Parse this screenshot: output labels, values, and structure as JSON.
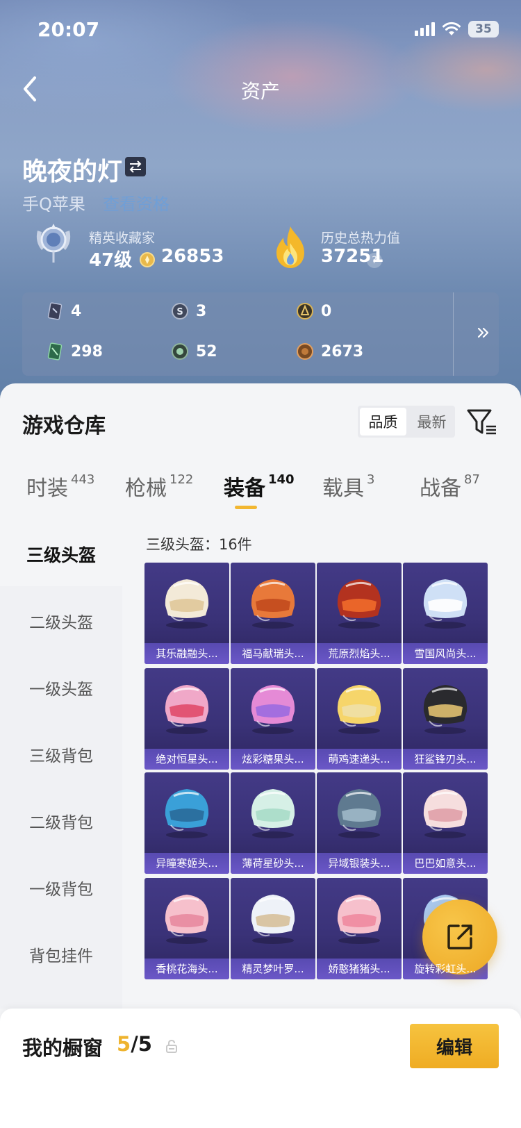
{
  "status_bar": {
    "time": "20:07",
    "battery": "35"
  },
  "header": {
    "title": "资产"
  },
  "profile": {
    "name": "晚夜的灯",
    "platform": "手Q苹果",
    "platform_extra": "查看资格",
    "rank_title": "精英收藏家",
    "rank_level": "47级",
    "rank_points": "26853",
    "heat_label": "历史总热力值",
    "heat_value": "37251",
    "help": "?"
  },
  "currencies": [
    {
      "icon": "dark-card-icon",
      "value": "4"
    },
    {
      "icon": "silver-coin-icon",
      "value": "3"
    },
    {
      "icon": "gold-emblem-icon",
      "value": "0"
    },
    {
      "icon": "green-card-icon",
      "value": "298"
    },
    {
      "icon": "green-orb-icon",
      "value": "52"
    },
    {
      "icon": "bronze-coin-icon",
      "value": "2673"
    }
  ],
  "warehouse": {
    "title": "游戏仓库",
    "sort_options": [
      "品质",
      "最新"
    ],
    "tabs": [
      {
        "label": "时装",
        "count": "443"
      },
      {
        "label": "枪械",
        "count": "122"
      },
      {
        "label": "装备",
        "count": "140"
      },
      {
        "label": "载具",
        "count": "3"
      },
      {
        "label": "战备",
        "count": "87"
      }
    ],
    "active_tab": "装备",
    "sub_categories": [
      "三级头盔",
      "二级头盔",
      "一级头盔",
      "三级背包",
      "二级背包",
      "一级背包",
      "背包挂件"
    ],
    "active_sub": "三级头盔",
    "grid_count": "三级头盔：16件",
    "items": [
      "其乐融融头...",
      "福马献瑞头...",
      "荒原烈焰头...",
      "雪国风尚头...",
      "绝对恒星头...",
      "炫彩糖果头...",
      "萌鸡速递头...",
      "狂鲨锋刃头...",
      "异瞳寒姬头...",
      "薄荷星砂头...",
      "异域银装头...",
      "巴巴如意头...",
      "香桃花海头...",
      "精灵梦叶罗...",
      "娇憨猪猪头...",
      "旋转彩虹头..."
    ]
  },
  "showcase": {
    "title": "我的橱窗",
    "current": "5",
    "total": "/5",
    "edit_label": "编辑"
  },
  "colors": {
    "accent": "#f2b731",
    "card_bg": "#3a3278",
    "card_label_bg": "#6a5acd"
  }
}
